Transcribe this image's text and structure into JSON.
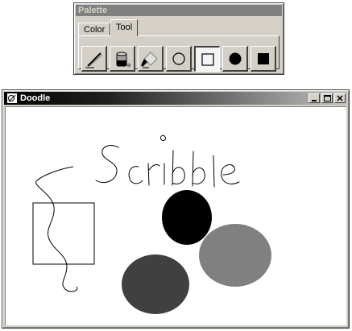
{
  "palette": {
    "title": "Palette",
    "tabs": [
      {
        "label": "Color"
      },
      {
        "label": "Tool"
      }
    ],
    "selected_tab": "Tool",
    "tools": [
      {
        "icon": "pen-icon"
      },
      {
        "icon": "paint-bucket-icon"
      },
      {
        "icon": "eraser-icon"
      },
      {
        "icon": "circle-outline-icon"
      },
      {
        "icon": "square-outline-icon"
      },
      {
        "icon": "circle-filled-icon"
      },
      {
        "icon": "square-filled-icon"
      }
    ],
    "selected_tool": "square-outline-icon"
  },
  "doodle": {
    "title": "Doodle",
    "text": "Scribble",
    "colors": {
      "black_circle": "#000000",
      "dark_circle": "#404040",
      "gray_circle": "#808080"
    }
  }
}
